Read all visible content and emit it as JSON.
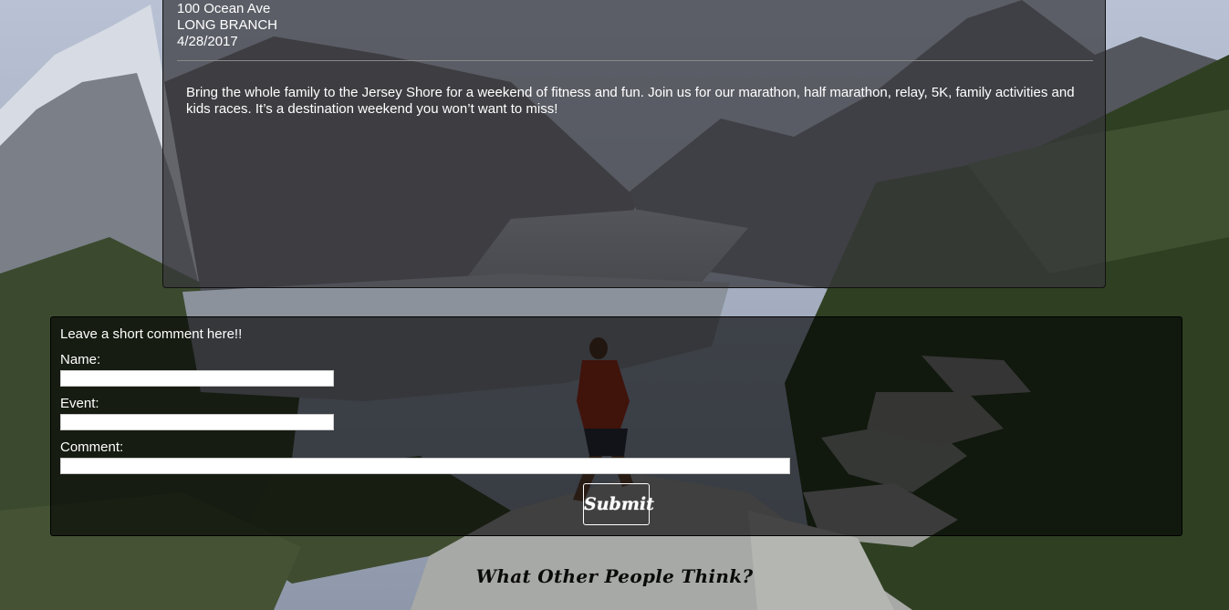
{
  "event": {
    "address_line": "100 Ocean Ave",
    "city": "LONG BRANCH",
    "date": "4/28/2017",
    "description": "Bring the whole family to the Jersey Shore for a weekend of fitness and fun. Join us for our marathon, half marathon, relay, 5K, family activities and kids races. It’s a destination weekend you won’t want to miss!"
  },
  "comment_form": {
    "heading": "Leave a short comment here!!",
    "name_label": "Name:",
    "name_value": "",
    "event_label": "Event:",
    "event_value": "",
    "comment_label": "Comment:",
    "comment_value": "",
    "submit_label": "Submit"
  },
  "reviews": {
    "title": "What Other People Think?"
  }
}
